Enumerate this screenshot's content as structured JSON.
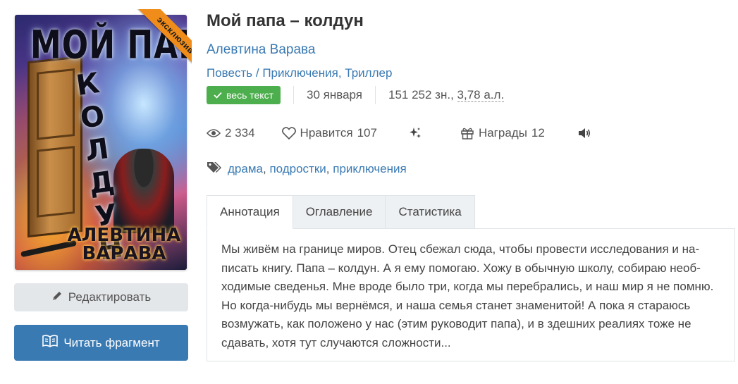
{
  "book": {
    "title": "Мой папа – колдун",
    "author": "Алевтина Варава",
    "genres": [
      "Повесть",
      "Приключения",
      "Триллер"
    ],
    "badge_exclusive": "эксклюзив",
    "cover_title": "МОЙ ПАПА",
    "cover_title_vertical": "КОЛДУН",
    "cover_author": "АЛЕВТИНА ВАРАВА",
    "full_text_badge": "весь текст",
    "date": "30 января",
    "size_chars": "151 252 зн., ",
    "size_al": "3,78 а.л."
  },
  "stats": {
    "views": "2 334",
    "likes_label": "Нравится",
    "likes": "107",
    "awards_label": "Награды",
    "awards": "12"
  },
  "tags": [
    "драма",
    "подростки",
    "приключения"
  ],
  "tabs": [
    {
      "label": "Аннотация",
      "active": true
    },
    {
      "label": "Оглавление",
      "active": false
    },
    {
      "label": "Статистика",
      "active": false
    }
  ],
  "annotation": "Мы живём на границе миров. Отец сбежал сюда, чтобы провести исследования и на­писать книгу. Папа – колдун. А я ему помогаю. Хожу в обычную школу, собираю необ­ходимые сведенья. Мне вроде было три, когда мы перебрались, и наш мир я не по­мню. Но когда-нибудь мы вернёмся, и наша семья станет знаменитой! А пока я стара­юсь возмужать, как положено у нас (этим руководит папа), и в здешних реалиях тоже не сдавать, хотя тут случаются сложности...",
  "buttons": {
    "edit": "Редактировать",
    "read": "Читать фрагмент"
  },
  "colors": {
    "link": "#3a7ab2",
    "badge_green": "#4cae4c",
    "exclusive_orange": "#f08c1a",
    "read_button": "#3a7ab2"
  }
}
